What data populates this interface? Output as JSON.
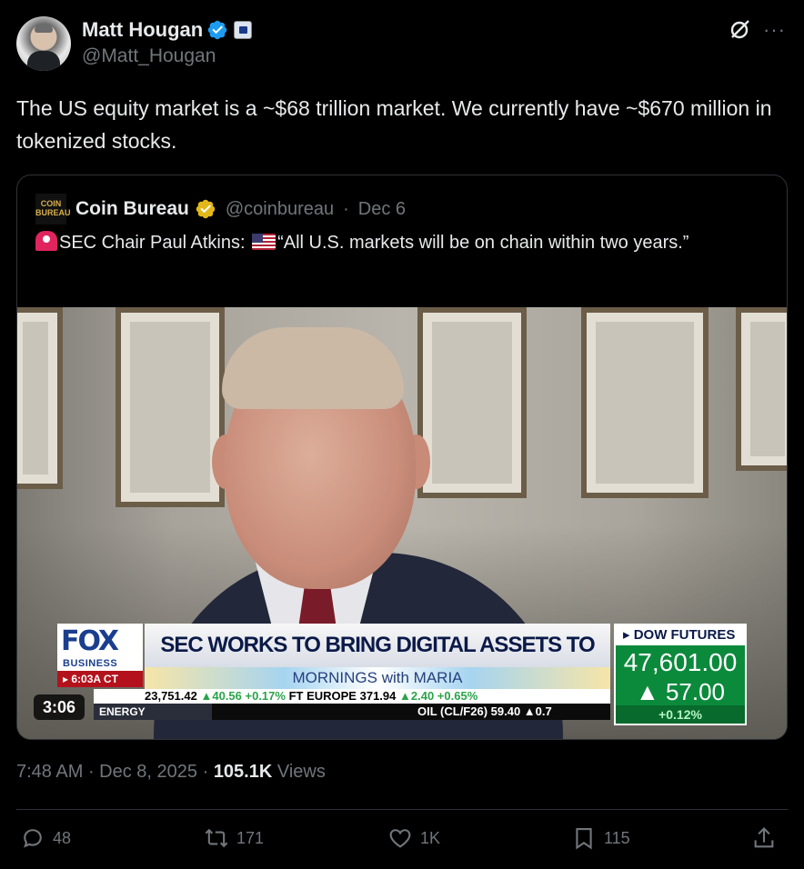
{
  "author": {
    "display_name": "Matt Hougan",
    "handle": "@Matt_Hougan",
    "avatar_icon": "user-avatar",
    "verified_color": "#1d9bf0"
  },
  "tweet": {
    "text": "The US equity market is a ~$68 trillion market.  We currently have ~$670 million in tokenized stocks."
  },
  "quote": {
    "avatar_text": "COIN BUREAU",
    "display_name": "Coin Bureau",
    "handle": "@coinbureau",
    "separator": "·",
    "date": "Dec 6",
    "text_before_flag": "SEC Chair Paul Atkins: ",
    "text_after_flag": "“All U.S. markets will be on chain within two years.”",
    "verified_color": "#e2b719",
    "video": {
      "duration": "3:06",
      "fox_logo": "FOX",
      "fox_sub": "BUSINESS",
      "time": "▸ 6:03A CT",
      "headline": "SEC WORKS TO BRING DIGITAL ASSETS TO INVESTORS",
      "show": "MORNINGS with MARIA",
      "ticker1_a": "23,751.42",
      "ticker1_b": "▲40.56",
      "ticker1_c": "+0.17%",
      "ticker1_d": "FT EUROPE",
      "ticker1_e": "371.94",
      "ticker1_f": "▲2.40",
      "ticker1_g": "+0.65%",
      "ticker2_energy": "ENERGY",
      "ticker2_oil": "OIL (CL/F26)  59.40  ▲0.7",
      "dow_title": "▸ DOW FUTURES",
      "dow_value": "47,601.00",
      "dow_change": "▲ 57.00",
      "dow_pct": "+0.12%"
    }
  },
  "meta": {
    "time": "7:48 AM",
    "sep1": " · ",
    "date": "Dec 8, 2025",
    "sep2": " · ",
    "views_count": "105.1K",
    "views_label": "Views"
  },
  "actions": {
    "replies": "48",
    "reposts": "171",
    "likes": "1K",
    "bookmarks": "115"
  }
}
